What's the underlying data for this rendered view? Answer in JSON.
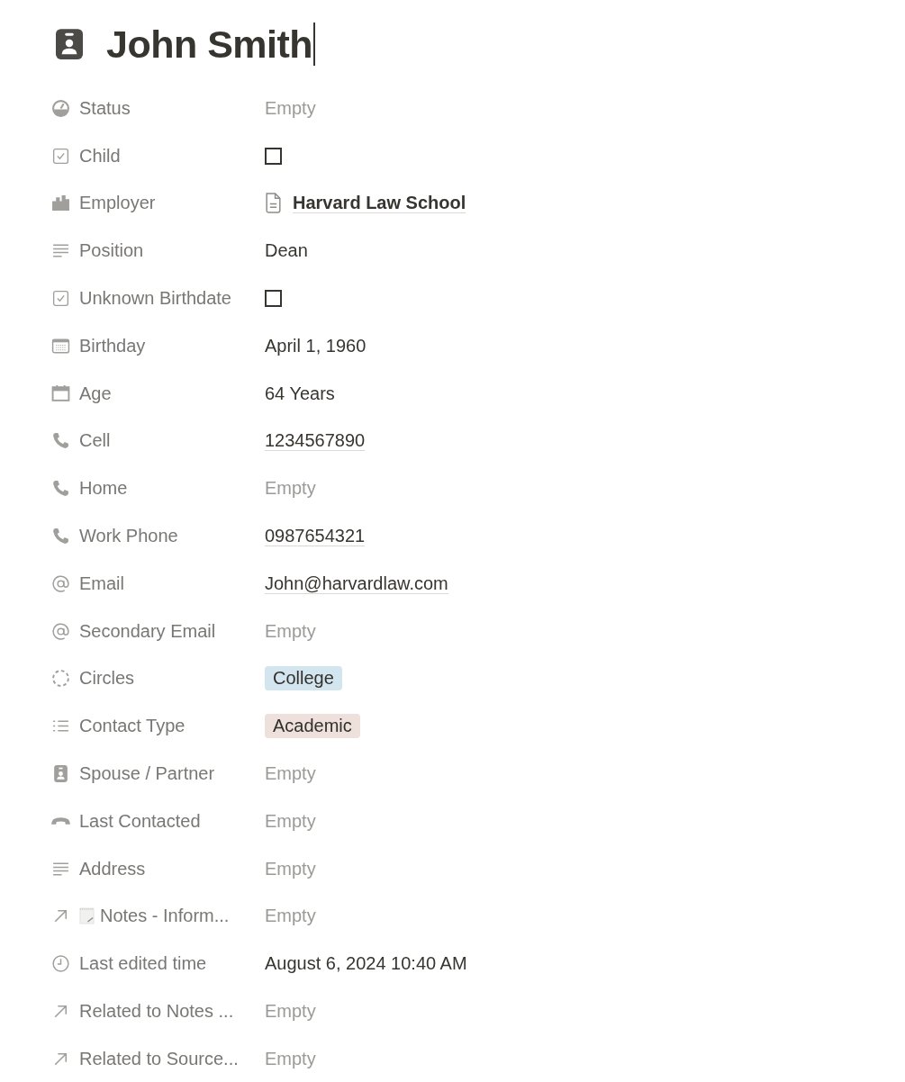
{
  "page": {
    "title": "John Smith"
  },
  "properties": [
    {
      "label": "Status",
      "kind": "status",
      "value": "Empty",
      "empty": true
    },
    {
      "label": "Child",
      "kind": "checkbox",
      "checked": false
    },
    {
      "label": "Employer",
      "kind": "company",
      "value": "Harvard Law School",
      "empty": false
    },
    {
      "label": "Position",
      "kind": "text",
      "value": "Dean",
      "empty": false
    },
    {
      "label": "Unknown Birthdate",
      "kind": "checkbox",
      "checked": false
    },
    {
      "label": "Birthday",
      "kind": "date",
      "value": "April 1, 1960",
      "empty": false
    },
    {
      "label": "Age",
      "kind": "age",
      "value": "64 Years",
      "empty": false
    },
    {
      "label": "Cell",
      "kind": "phone",
      "value": "1234567890",
      "empty": false
    },
    {
      "label": "Home",
      "kind": "phone",
      "value": "Empty",
      "empty": true
    },
    {
      "label": "Work Phone",
      "kind": "phone",
      "value": "0987654321",
      "empty": false
    },
    {
      "label": "Email",
      "kind": "email",
      "value": "John@harvardlaw.com",
      "empty": false
    },
    {
      "label": "Secondary Email",
      "kind": "email",
      "value": "Empty",
      "empty": true
    },
    {
      "label": "Circles",
      "kind": "multi_select",
      "value": "College",
      "empty": false,
      "color": "#d3e5ef"
    },
    {
      "label": "Contact Type",
      "kind": "select",
      "value": "Academic",
      "empty": false,
      "color": "#eee0da"
    },
    {
      "label": "Spouse / Partner",
      "kind": "person",
      "value": "Empty",
      "empty": true
    },
    {
      "label": "Last Contacted",
      "kind": "call",
      "value": "Empty",
      "empty": true
    },
    {
      "label": "Address",
      "kind": "text",
      "value": "Empty",
      "empty": true
    },
    {
      "label": "Notes - Inform...",
      "kind": "relation",
      "has_page_icon": true,
      "value": "Empty",
      "empty": true
    },
    {
      "label": "Last edited time",
      "kind": "edited_time",
      "value": "August 6, 2024 10:40 AM",
      "empty": false
    },
    {
      "label": "Related to Notes ...",
      "kind": "relation",
      "has_page_icon": false,
      "value": "Empty",
      "empty": true
    },
    {
      "label": "Related to Source...",
      "kind": "relation",
      "has_page_icon": false,
      "value": "Empty",
      "empty": true
    }
  ]
}
